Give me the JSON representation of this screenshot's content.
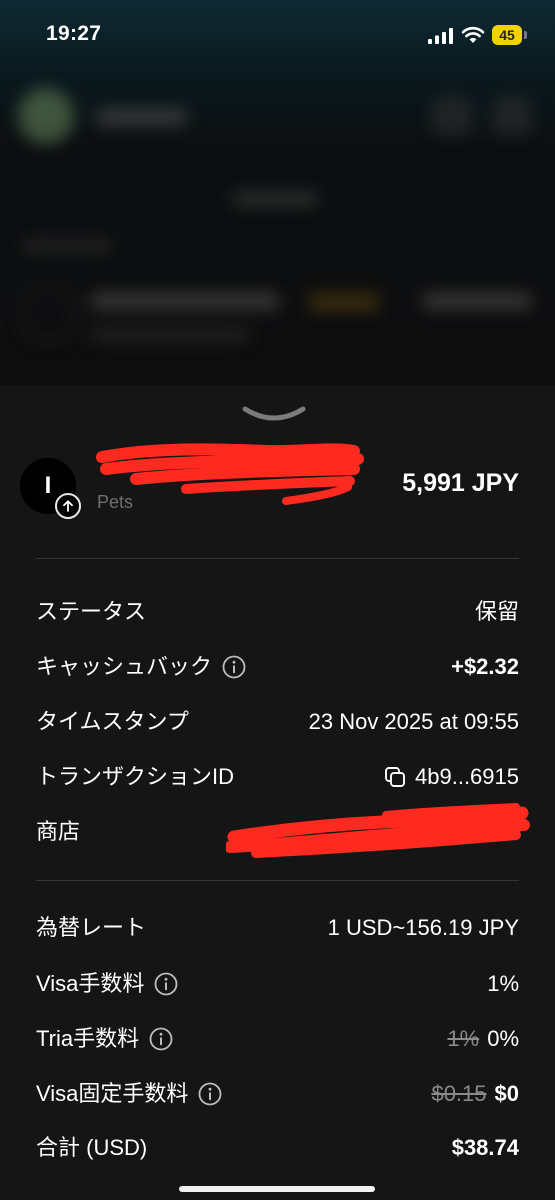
{
  "status_bar": {
    "time": "19:27",
    "battery": "45"
  },
  "merchant": {
    "avatar_letter": "I",
    "category": "Pets"
  },
  "transaction": {
    "amount": "5,991 JPY"
  },
  "details": {
    "status": {
      "label": "ステータス",
      "value": "保留"
    },
    "cashback": {
      "label": "キャッシュバック",
      "value": "+$2.32"
    },
    "timestamp": {
      "label": "タイムスタンプ",
      "value": "23 Nov 2025 at 09:55"
    },
    "transaction_id": {
      "label": "トランザクションID",
      "value": "4b9...6915"
    },
    "merchant": {
      "label": "商店"
    }
  },
  "fees": {
    "exchange_rate": {
      "label": "為替レート",
      "value": "1 USD~156.19 JPY"
    },
    "visa_fee": {
      "label": "Visa手数料",
      "value": "1%"
    },
    "tria_fee": {
      "label": "Tria手数料",
      "old_value": "1%",
      "value": "0%"
    },
    "visa_fixed_fee": {
      "label": "Visa固定手数料",
      "old_value": "$0.15",
      "value": "$0"
    },
    "total": {
      "label": "合計 (USD)",
      "value": "$38.74"
    }
  },
  "colors": {
    "cashback": "#f39a34",
    "redaction": "#ff2a1f",
    "battery": "#f2d300"
  },
  "icons": [
    "signal-icon",
    "wifi-icon",
    "chevron-down-icon",
    "arrow-up-icon",
    "info-icon",
    "copy-icon"
  ]
}
